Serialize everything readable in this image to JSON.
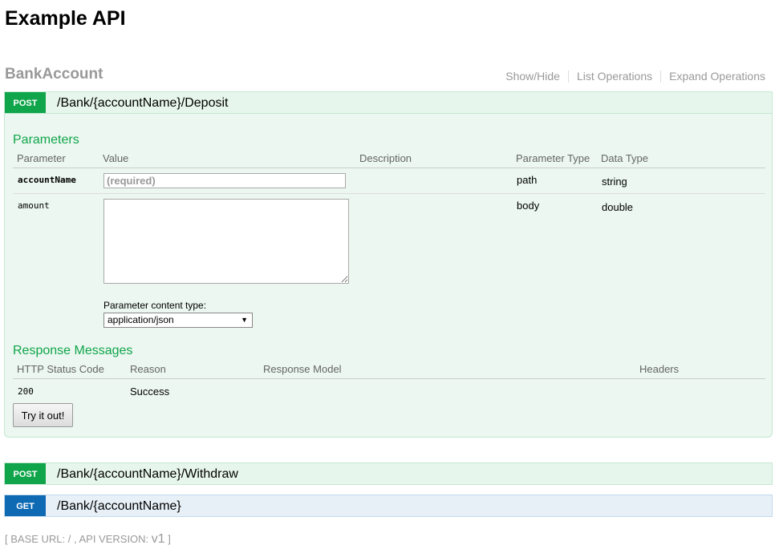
{
  "page": {
    "title": "Example API"
  },
  "resource": {
    "name": "BankAccount",
    "links": {
      "show_hide": "Show/Hide",
      "list_operations": "List Operations",
      "expand_operations": "Expand Operations"
    }
  },
  "operations": [
    {
      "method": "POST",
      "path": "/Bank/{accountName}/Deposit"
    },
    {
      "method": "POST",
      "path": "/Bank/{accountName}/Withdraw"
    },
    {
      "method": "GET",
      "path": "/Bank/{accountName}"
    }
  ],
  "deposit": {
    "parameters_title": "Parameters",
    "param_headers": {
      "parameter": "Parameter",
      "value": "Value",
      "description": "Description",
      "parameter_type": "Parameter Type",
      "data_type": "Data Type"
    },
    "params": [
      {
        "name": "accountName",
        "placeholder": "(required)",
        "parameter_type": "path",
        "data_type": "string"
      },
      {
        "name": "amount",
        "parameter_type": "body",
        "data_type": "double"
      }
    ],
    "content_type_label": "Parameter content type:",
    "content_type_selected": "application/json",
    "response_title": "Response Messages",
    "response_headers": {
      "status": "HTTP Status Code",
      "reason": "Reason",
      "model": "Response Model",
      "headers": "Headers"
    },
    "responses": [
      {
        "code": "200",
        "reason": "Success"
      }
    ],
    "try_button": "Try it out!"
  },
  "footer": {
    "prefix": "[ BASE URL: / , API VERSION: ",
    "version": "v1",
    "suffix": " ]"
  },
  "colors": {
    "post": "#10a54a",
    "get": "#0f6ab4",
    "section_title": "#10a54a"
  }
}
